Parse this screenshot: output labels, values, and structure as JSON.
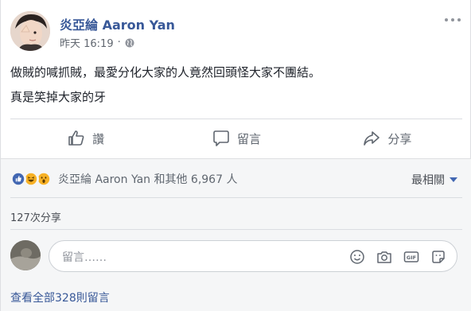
{
  "post": {
    "author": "炎亞綸 Aaron Yan",
    "timestamp": "昨天 16:19",
    "privacy_separator": "·",
    "privacy_icon": "globe-icon",
    "more_icon": "more-options-icon",
    "text_lines": [
      "做賊的喊抓賊，最愛分化大家的人竟然回頭怪大家不團結。",
      "真是笑掉大家的牙"
    ]
  },
  "actions": {
    "like_label": "讚",
    "comment_label": "留言",
    "share_label": "分享"
  },
  "reactions": {
    "icons": [
      "like-reaction-icon",
      "haha-reaction-icon",
      "wow-reaction-icon"
    ],
    "summary": "炎亞綸 Aaron Yan 和其他 6,967 人",
    "sort_label": "最相關"
  },
  "shares": {
    "count_text": "127次分享"
  },
  "composer": {
    "placeholder": "留言……",
    "icons": [
      "emoji-icon",
      "camera-icon",
      "gif-icon",
      "sticker-icon"
    ]
  },
  "comments": {
    "view_all_text": "查看全部328則留言"
  },
  "colors": {
    "link": "#385898",
    "like_blue": "#4267b2",
    "reaction_yellow": "#f7b125"
  }
}
